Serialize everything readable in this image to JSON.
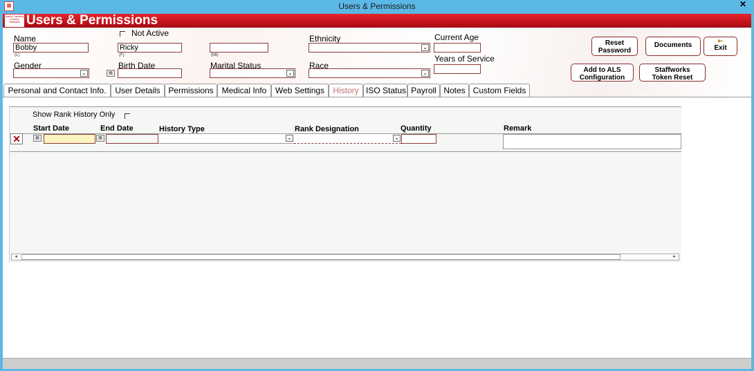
{
  "window": {
    "title": "Users & Permissions",
    "close_label": "✕",
    "app_icon": "app-logo-icon"
  },
  "banner": {
    "title": "Users & Permissions",
    "logo_text": "North Carolina County Software"
  },
  "form": {
    "name_label": "Name",
    "last_name": "Bobby",
    "last_hint": "(L)",
    "first_name": "Ricky",
    "first_hint": "(F)",
    "middle_initial": "",
    "middle_hint": "(MI)",
    "not_active_label": "Not Active",
    "not_active_checked": false,
    "ethnicity_label": "Ethnicity",
    "ethnicity_value": "",
    "current_age_label": "Current Age",
    "current_age_value": "",
    "years_of_service_label": "Years of Service",
    "years_of_service_value": "",
    "gender_label": "Gender",
    "gender_value": "",
    "birth_date_label": "Birth Date",
    "birth_date_value": "",
    "marital_status_label": "Marital Status",
    "marital_status_value": "",
    "race_label": "Race",
    "race_value": ""
  },
  "buttons": {
    "reset_password_line1": "Reset",
    "reset_password_line2": "Password",
    "documents": "Documents",
    "exit": "Exit",
    "add_als_line1": "Add to ALS",
    "add_als_line2": "Configuration",
    "staffworks_line1": "Staffworks",
    "staffworks_line2": "Token Reset"
  },
  "tabs": [
    {
      "label": "Personal and Contact Info."
    },
    {
      "label": "User Details"
    },
    {
      "label": "Permissions"
    },
    {
      "label": "Medical Info"
    },
    {
      "label": "Web Settings"
    },
    {
      "label": "History"
    },
    {
      "label": "ISO Status"
    },
    {
      "label": "Payroll"
    },
    {
      "label": "Notes"
    },
    {
      "label": "Custom Fields"
    }
  ],
  "active_tab": "History",
  "history": {
    "show_rank_label": "Show Rank History Only",
    "show_rank_checked": false,
    "columns": {
      "start_date": "Start Date",
      "end_date": "End Date",
      "history_type": "History Type",
      "rank_designation": "Rank Designation",
      "quantity": "Quantity",
      "remark": "Remark"
    },
    "row": {
      "start_date": "",
      "end_date": "",
      "history_type": "",
      "rank_designation": "",
      "quantity": "",
      "remark": ""
    }
  },
  "colors": {
    "accent": "#c4111a",
    "titlebar": "#5bb8e6",
    "field_border": "#8b3a3a",
    "highlight_field": "#fdf5c0"
  }
}
